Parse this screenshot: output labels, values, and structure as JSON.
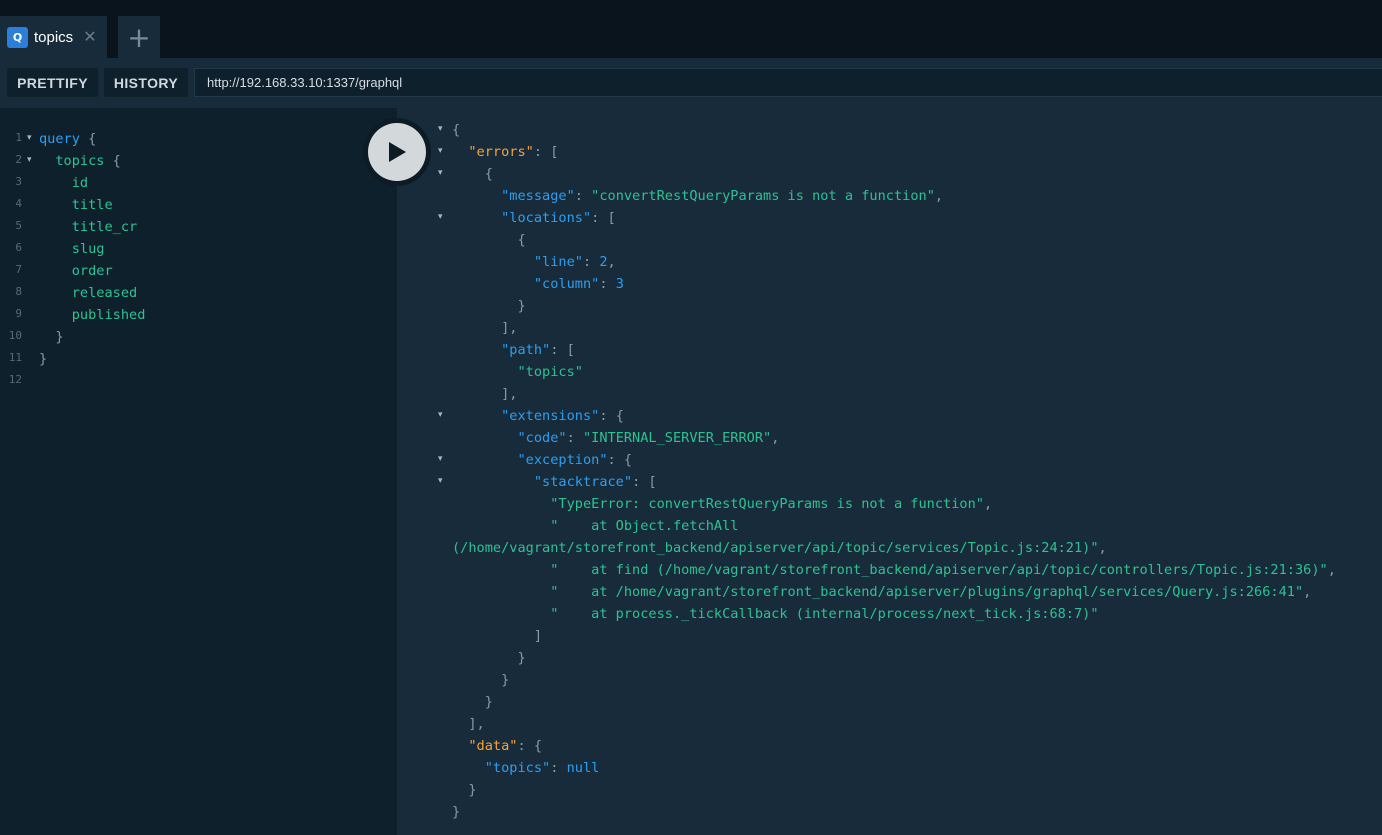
{
  "tabs": [
    {
      "badge": "Q",
      "title": "topics",
      "close": "✕"
    }
  ],
  "tab_add_label": "+",
  "toolbar": {
    "prettify_label": "PRETTIFY",
    "history_label": "HISTORY",
    "url": "http://192.168.33.10:1337/graphql"
  },
  "query": {
    "line_numbers": [
      "1",
      "2",
      "3",
      "4",
      "5",
      "6",
      "7",
      "8",
      "9",
      "10",
      "11",
      "12"
    ],
    "lines": [
      {
        "tokens": [
          {
            "c": "kw",
            "t": "query"
          },
          {
            "c": "pn",
            "t": " {"
          }
        ]
      },
      {
        "tokens": [
          {
            "c": "fld",
            "t": "  topics"
          },
          {
            "c": "pn",
            "t": " {"
          }
        ]
      },
      {
        "tokens": [
          {
            "c": "fld",
            "t": "    id"
          }
        ]
      },
      {
        "tokens": [
          {
            "c": "fld",
            "t": "    title"
          }
        ]
      },
      {
        "tokens": [
          {
            "c": "fld",
            "t": "    title_cr"
          }
        ]
      },
      {
        "tokens": [
          {
            "c": "fld",
            "t": "    slug"
          }
        ]
      },
      {
        "tokens": [
          {
            "c": "fld",
            "t": "    order"
          }
        ]
      },
      {
        "tokens": [
          {
            "c": "fld",
            "t": "    released"
          }
        ]
      },
      {
        "tokens": [
          {
            "c": "fld",
            "t": "    published"
          }
        ]
      },
      {
        "tokens": [
          {
            "c": "pn",
            "t": "  }"
          }
        ]
      },
      {
        "tokens": [
          {
            "c": "pn",
            "t": "}"
          }
        ]
      },
      {
        "tokens": []
      }
    ]
  },
  "result": {
    "lines": [
      {
        "fold": true,
        "tokens": [
          {
            "c": "pn",
            "t": "{"
          }
        ]
      },
      {
        "fold": true,
        "tokens": [
          {
            "c": "okey",
            "t": "  \"errors\""
          },
          {
            "c": "pn",
            "t": ": ["
          }
        ]
      },
      {
        "fold": true,
        "tokens": [
          {
            "c": "pn",
            "t": "    {"
          }
        ]
      },
      {
        "fold": false,
        "tokens": [
          {
            "c": "key",
            "t": "      \"message\""
          },
          {
            "c": "pn",
            "t": ": "
          },
          {
            "c": "str",
            "t": "\"convertRestQueryParams is not a function\""
          },
          {
            "c": "pn",
            "t": ","
          }
        ]
      },
      {
        "fold": true,
        "tokens": [
          {
            "c": "key",
            "t": "      \"locations\""
          },
          {
            "c": "pn",
            "t": ": ["
          }
        ]
      },
      {
        "fold": false,
        "tokens": [
          {
            "c": "pn",
            "t": "        {"
          }
        ]
      },
      {
        "fold": false,
        "tokens": [
          {
            "c": "key",
            "t": "          \"line\""
          },
          {
            "c": "pn",
            "t": ": "
          },
          {
            "c": "num",
            "t": "2"
          },
          {
            "c": "pn",
            "t": ","
          }
        ]
      },
      {
        "fold": false,
        "tokens": [
          {
            "c": "key",
            "t": "          \"column\""
          },
          {
            "c": "pn",
            "t": ": "
          },
          {
            "c": "num",
            "t": "3"
          }
        ]
      },
      {
        "fold": false,
        "tokens": [
          {
            "c": "pn",
            "t": "        }"
          }
        ]
      },
      {
        "fold": false,
        "tokens": [
          {
            "c": "pn",
            "t": "      ],"
          }
        ]
      },
      {
        "fold": false,
        "tokens": [
          {
            "c": "key",
            "t": "      \"path\""
          },
          {
            "c": "pn",
            "t": ": ["
          }
        ]
      },
      {
        "fold": false,
        "tokens": [
          {
            "c": "str",
            "t": "        \"topics\""
          }
        ]
      },
      {
        "fold": false,
        "tokens": [
          {
            "c": "pn",
            "t": "      ],"
          }
        ]
      },
      {
        "fold": true,
        "tokens": [
          {
            "c": "key",
            "t": "      \"extensions\""
          },
          {
            "c": "pn",
            "t": ": {"
          }
        ]
      },
      {
        "fold": false,
        "tokens": [
          {
            "c": "key",
            "t": "        \"code\""
          },
          {
            "c": "pn",
            "t": ": "
          },
          {
            "c": "str",
            "t": "\"INTERNAL_SERVER_ERROR\""
          },
          {
            "c": "pn",
            "t": ","
          }
        ]
      },
      {
        "fold": true,
        "tokens": [
          {
            "c": "key",
            "t": "        \"exception\""
          },
          {
            "c": "pn",
            "t": ": {"
          }
        ]
      },
      {
        "fold": true,
        "tokens": [
          {
            "c": "key",
            "t": "          \"stacktrace\""
          },
          {
            "c": "pn",
            "t": ": ["
          }
        ]
      },
      {
        "fold": false,
        "tokens": [
          {
            "c": "str",
            "t": "            \"TypeError: convertRestQueryParams is not a function\""
          },
          {
            "c": "pn",
            "t": ","
          }
        ]
      },
      {
        "fold": false,
        "tokens": [
          {
            "c": "str",
            "t": "            \"    at Object.fetchAll"
          }
        ]
      },
      {
        "fold": false,
        "tokens": [
          {
            "c": "str",
            "t": "(/home/vagrant/storefront_backend/apiserver/api/topic/services/Topic.js:24:21)\""
          },
          {
            "c": "pn",
            "t": ","
          }
        ]
      },
      {
        "fold": false,
        "tokens": [
          {
            "c": "str",
            "t": "            \"    at find (/home/vagrant/storefront_backend/apiserver/api/topic/controllers/Topic.js:21:36)\""
          },
          {
            "c": "pn",
            "t": ","
          }
        ]
      },
      {
        "fold": false,
        "tokens": [
          {
            "c": "str",
            "t": "            \"    at /home/vagrant/storefront_backend/apiserver/plugins/graphql/services/Query.js:266:41\""
          },
          {
            "c": "pn",
            "t": ","
          }
        ]
      },
      {
        "fold": false,
        "tokens": [
          {
            "c": "str",
            "t": "            \"    at process._tickCallback (internal/process/next_tick.js:68:7)\""
          }
        ]
      },
      {
        "fold": false,
        "tokens": [
          {
            "c": "pn",
            "t": "          ]"
          }
        ]
      },
      {
        "fold": false,
        "tokens": [
          {
            "c": "pn",
            "t": "        }"
          }
        ]
      },
      {
        "fold": false,
        "tokens": [
          {
            "c": "pn",
            "t": "      }"
          }
        ]
      },
      {
        "fold": false,
        "tokens": [
          {
            "c": "pn",
            "t": "    }"
          }
        ]
      },
      {
        "fold": false,
        "tokens": [
          {
            "c": "pn",
            "t": "  ],"
          }
        ]
      },
      {
        "fold": false,
        "tokens": [
          {
            "c": "okey",
            "t": "  \"data\""
          },
          {
            "c": "pn",
            "t": ": {"
          }
        ]
      },
      {
        "fold": false,
        "tokens": [
          {
            "c": "key",
            "t": "    \"topics\""
          },
          {
            "c": "pn",
            "t": ": "
          },
          {
            "c": "num",
            "t": "null"
          }
        ]
      },
      {
        "fold": false,
        "tokens": [
          {
            "c": "pn",
            "t": "  }"
          }
        ]
      },
      {
        "fold": false,
        "tokens": [
          {
            "c": "pn",
            "t": "}"
          }
        ]
      }
    ]
  },
  "icons": {
    "play": "play-icon",
    "fold": "fold-arrow-icon"
  },
  "colors": {
    "keyword": "#2e9ef0",
    "field": "#2fc193",
    "orange_key": "#f7a23b",
    "badge": "#2c7fd9"
  }
}
